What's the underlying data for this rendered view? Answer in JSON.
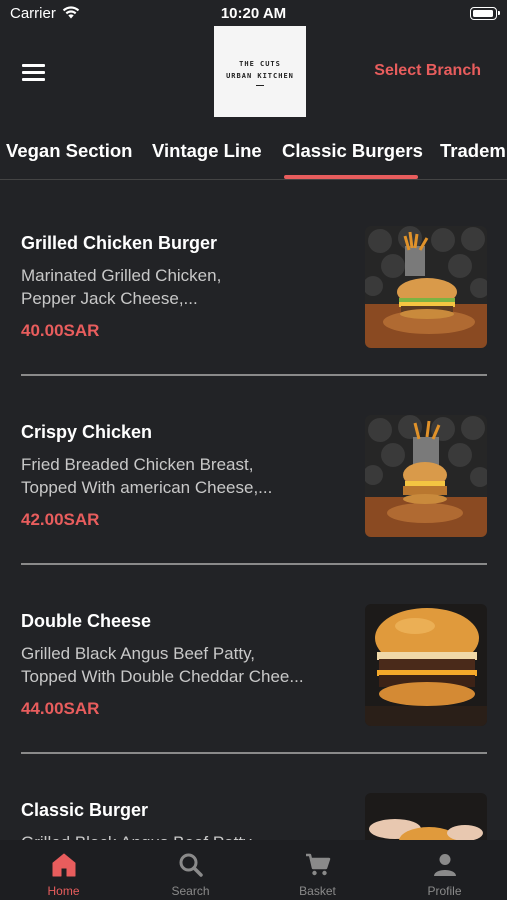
{
  "status_bar": {
    "carrier": "Carrier",
    "time": "10:20 AM"
  },
  "header": {
    "logo_line1": "THE CUTS",
    "logo_line2": "URBAN KITCHEN",
    "select_branch": "Select Branch"
  },
  "category_tabs": [
    "Vegan Section",
    "Vintage Line",
    "Classic Burgers",
    "Tradem"
  ],
  "active_tab": "Classic Burgers",
  "menu_items": [
    {
      "name": "Grilled Chicken Burger",
      "desc_line1": "Marinated Grilled Chicken,",
      "desc_line2": "Pepper Jack Cheese,...",
      "price": "40.00SAR"
    },
    {
      "name": "Crispy Chicken",
      "desc_line1": "Fried Breaded Chicken Breast,",
      "desc_line2": "Topped With american Cheese,...",
      "price": "42.00SAR"
    },
    {
      "name": "Double Cheese",
      "desc_line1": "Grilled Black Angus Beef Patty,",
      "desc_line2": "Topped With Double Cheddar Chee...",
      "price": "44.00SAR"
    },
    {
      "name": "Classic Burger",
      "desc_line1": "Grilled Black Angus Beef Patty,",
      "desc_line2": "",
      "price": ""
    }
  ],
  "bottom_nav": [
    {
      "label": "Home",
      "icon": "home-icon",
      "active": true
    },
    {
      "label": "Search",
      "icon": "search-icon",
      "active": false
    },
    {
      "label": "Basket",
      "icon": "cart-icon",
      "active": false
    },
    {
      "label": "Profile",
      "icon": "profile-icon",
      "active": false
    }
  ],
  "colors": {
    "accent": "#e85d5d",
    "background": "#222326",
    "tab_bar": "#1d1e21"
  }
}
